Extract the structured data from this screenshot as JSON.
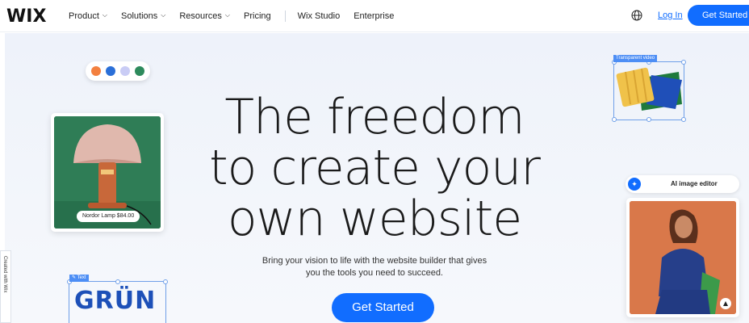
{
  "nav": {
    "logo": "WIX",
    "menu": [
      {
        "label": "Product",
        "dropdown": true
      },
      {
        "label": "Solutions",
        "dropdown": true
      },
      {
        "label": "Resources",
        "dropdown": true
      },
      {
        "label": "Pricing",
        "dropdown": false
      }
    ],
    "menu_right": [
      {
        "label": "Wix Studio"
      },
      {
        "label": "Enterprise"
      }
    ],
    "globe_icon": "globe-icon",
    "login": "Log In",
    "cta": "Get Started"
  },
  "hero": {
    "headline": [
      "The freedom",
      "to create your",
      "own website"
    ],
    "subtitle": [
      "Bring your vision to life with the website builder that gives",
      "you the tools you need to succeed."
    ],
    "cta": "Get Started"
  },
  "decor": {
    "swatches": [
      "#f3803f",
      "#2a6fd8",
      "#c9ccf5",
      "#2d8a5c"
    ],
    "product_price": "Nordor Lamp $84.00",
    "video_tag": "Transparent video",
    "text_tag": "Text",
    "brand_text": "GRÜN",
    "ai_label": "AI image editor",
    "side_badge": "Created with Wix"
  },
  "colors": {
    "accent": "#116dff",
    "lamp_bg": "#2f7d56",
    "portrait_bg": "#d9784a"
  }
}
